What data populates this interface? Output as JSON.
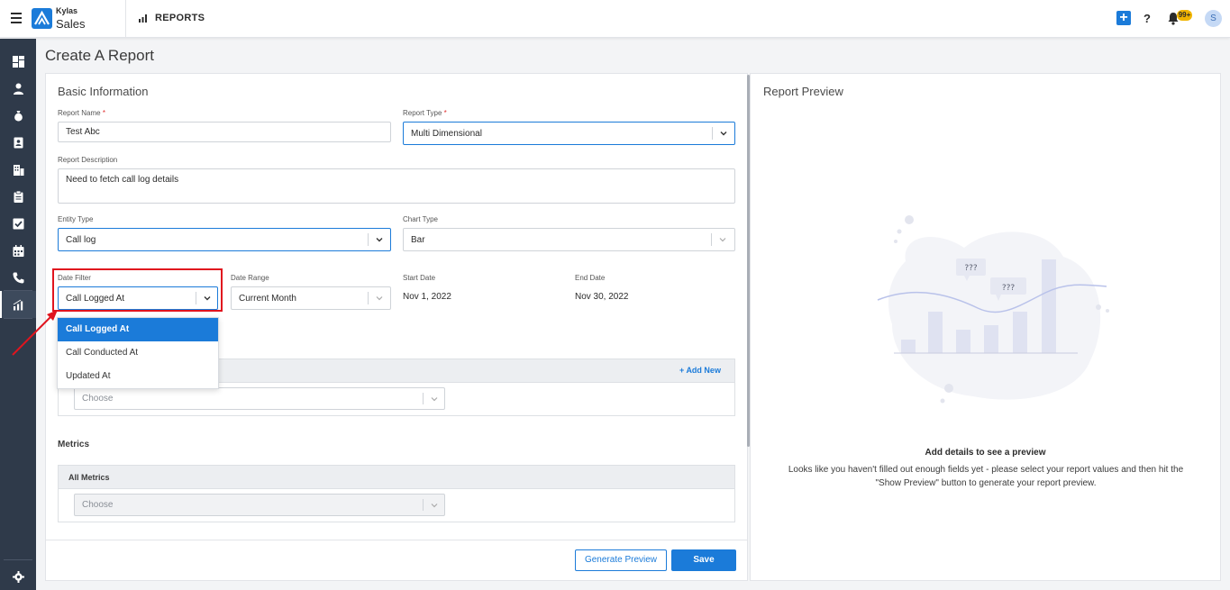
{
  "app": {
    "brand_top": "Kylas",
    "brand_bottom": "Sales",
    "module_title": "REPORTS",
    "notification_count": "99+",
    "avatar_initial": "S"
  },
  "page": {
    "title": "Create A Report"
  },
  "basic_info": {
    "section_title": "Basic Information",
    "report_name": {
      "label": "Report Name",
      "required_mark": "*",
      "value": "Test Abc"
    },
    "report_type": {
      "label": "Report Type",
      "required_mark": "*",
      "value": "Multi Dimensional"
    },
    "report_description": {
      "label": "Report Description",
      "value": "Need to fetch call log details"
    },
    "entity_type": {
      "label": "Entity Type",
      "value": "Call log"
    },
    "chart_type": {
      "label": "Chart Type",
      "value": "Bar"
    },
    "date_filter": {
      "label": "Date Filter",
      "value": "Call Logged At",
      "options": [
        "Call Logged At",
        "Call Conducted At",
        "Updated At"
      ]
    },
    "date_range": {
      "label": "Date Range",
      "value": "Current Month"
    },
    "start_date": {
      "label": "Start Date",
      "value": "Nov 1, 2022"
    },
    "end_date": {
      "label": "End Date",
      "value": "Nov 30, 2022"
    }
  },
  "group_by": {
    "add_new_label": "Add New",
    "select_placeholder": "Choose"
  },
  "metrics": {
    "section_title": "Metrics",
    "group_label": "All Metrics",
    "select_placeholder": "Choose"
  },
  "actions": {
    "generate_preview_label": "Generate Preview",
    "save_label": "Save"
  },
  "preview": {
    "title": "Report Preview",
    "bubble_1": "???",
    "bubble_2": "???",
    "heading": "Add details to see a preview",
    "description": "Looks like you haven't filled out enough fields yet - please select your report values and then hit the \"Show Preview\" button to generate your report preview."
  },
  "colors": {
    "accent": "#1b7bd9",
    "sidebar": "#2f3a4a",
    "highlight": "#e0141e"
  },
  "icons": {
    "sidebar": [
      "dashboard-icon",
      "contact-icon",
      "money-bag-icon",
      "contact-card-icon",
      "company-icon",
      "clipboard-icon",
      "checkbox-icon",
      "calendar-icon",
      "phone-icon",
      "reports-chart-icon",
      "settings-icon"
    ]
  }
}
